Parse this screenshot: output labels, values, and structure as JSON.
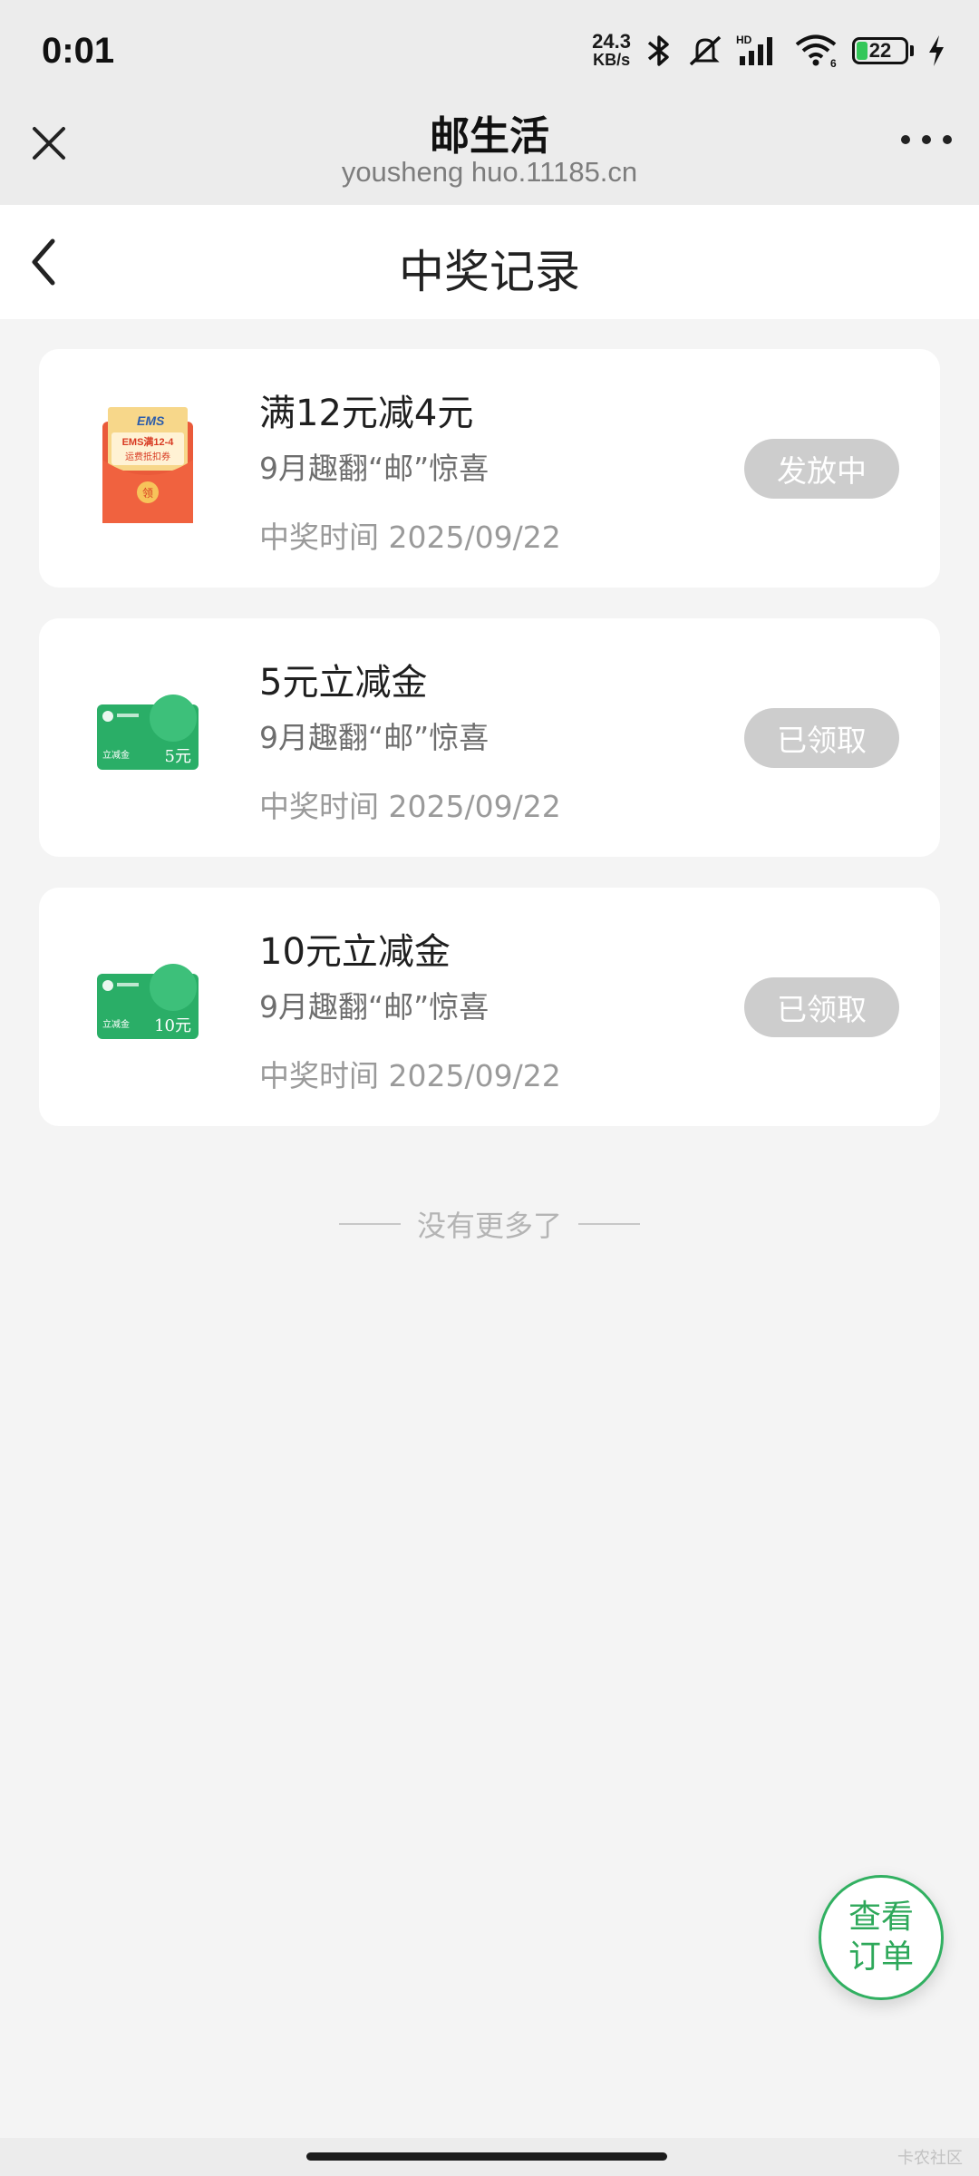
{
  "status_bar": {
    "time": "0:01",
    "net_speed_value": "24.3",
    "net_speed_unit": "KB/s",
    "battery_level": "22",
    "icons": [
      "bluetooth-icon",
      "mute-icon",
      "signal-hd-icon",
      "wifi-6-icon",
      "battery-icon",
      "charging-icon"
    ]
  },
  "browser": {
    "title": "邮生活",
    "url": "yousheng huo.11185.cn"
  },
  "page": {
    "title": "中奖记录"
  },
  "records": [
    {
      "title": "满12元减4元",
      "subtitle": "9月趣翻“邮”惊喜",
      "time": "中奖时间 2025/09/22",
      "status": "发放中",
      "thumb": "ems-coupon-envelope",
      "thumb_text": "EMS满12-4",
      "thumb_text2": "运费抵扣券",
      "thumb_badge": "领"
    },
    {
      "title": "5元立减金",
      "subtitle": "9月趣翻“邮”惊喜",
      "time": "中奖时间 2025/09/22",
      "status": "已领取",
      "thumb": "wechat-pay-card",
      "thumb_text": "立减金",
      "thumb_value": "5元"
    },
    {
      "title": "10元立减金",
      "subtitle": "9月趣翻“邮”惊喜",
      "time": "中奖时间 2025/09/22",
      "status": "已领取",
      "thumb": "wechat-pay-card",
      "thumb_text": "立减金",
      "thumb_value": "10元"
    }
  ],
  "footer": {
    "end_text": "没有更多了",
    "fab_line1": "查看",
    "fab_line2": "订单",
    "watermark": "卡农社区"
  },
  "colors": {
    "accent_green": "#31b061",
    "status_pill": "#cdcdcd",
    "page_bg": "#f4f4f4"
  }
}
